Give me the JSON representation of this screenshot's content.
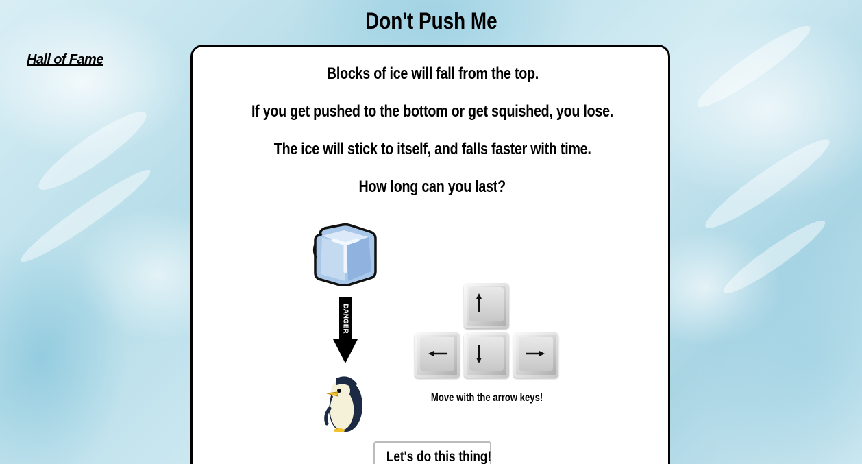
{
  "page": {
    "title": "Don't Push Me",
    "hall_of_fame_link": "Hall of Fame"
  },
  "instructions": [
    "Blocks of ice will fall from the top.",
    "If you get pushed to the bottom or get squished, you lose.",
    "The ice will stick to itself, and falls faster with time.",
    "How long can you last?"
  ],
  "illustration": {
    "arrow_label": "DANGER",
    "icons": [
      "ice-cube-icon",
      "down-arrow-icon",
      "penguin-icon"
    ]
  },
  "controls": {
    "caption": "Move with the arrow keys!",
    "keys": [
      "up-arrow-key",
      "left-arrow-key",
      "down-arrow-key",
      "right-arrow-key"
    ]
  },
  "start_button_label": "Let's do this thing!"
}
